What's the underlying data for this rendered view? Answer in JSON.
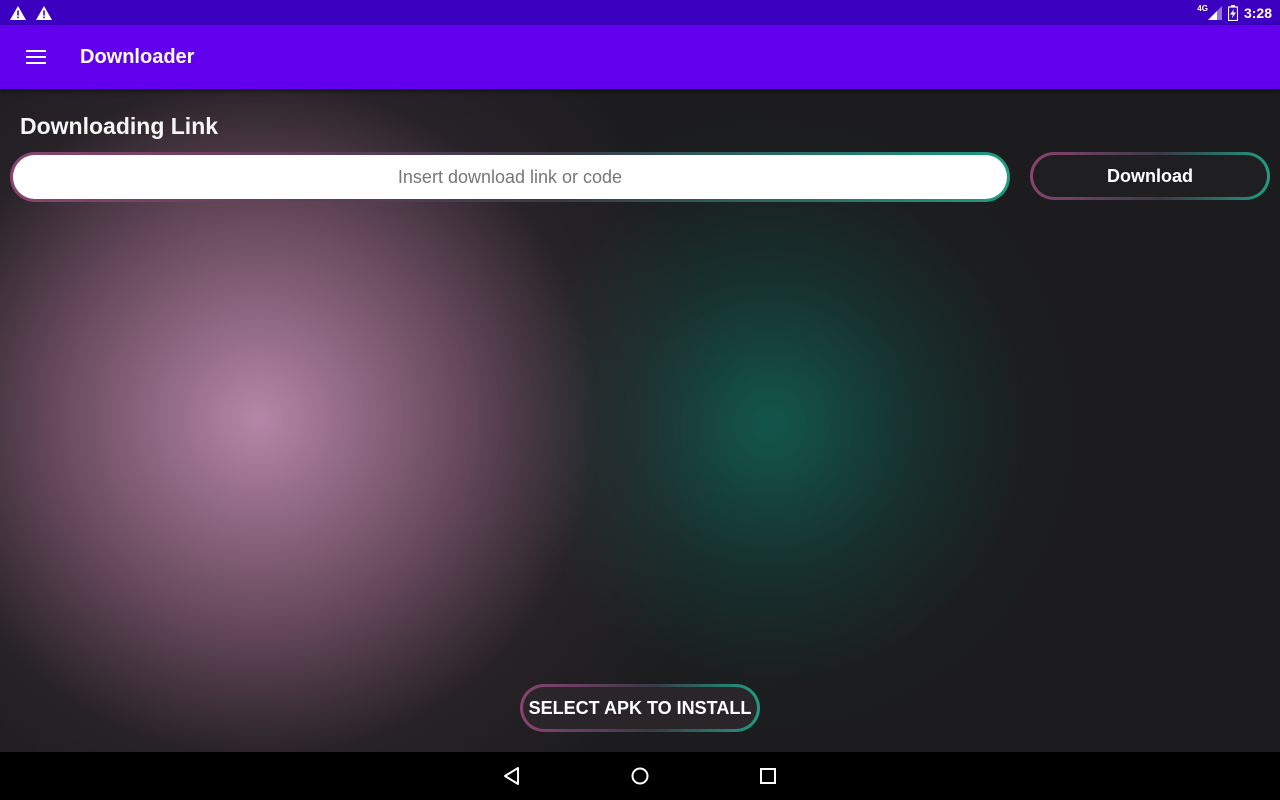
{
  "status_bar": {
    "time": "3:28",
    "network": "4G"
  },
  "app_bar": {
    "title": "Downloader",
    "menu_icon": "menu-icon"
  },
  "main": {
    "section_title": "Downloading Link",
    "link_input": {
      "placeholder": "Insert download link or code",
      "value": ""
    },
    "download_button_label": "Download",
    "select_apk_button_label": "SELECT APK TO INSTALL"
  },
  "colors": {
    "status_bar": "#3c00c0",
    "app_bar": "#6200ee",
    "background": "#1c1c1e",
    "accent_pink": "#8a4470",
    "accent_teal": "#1e9c82"
  },
  "nav_bar": {
    "icons": [
      "back-icon",
      "home-icon",
      "recents-icon"
    ]
  }
}
